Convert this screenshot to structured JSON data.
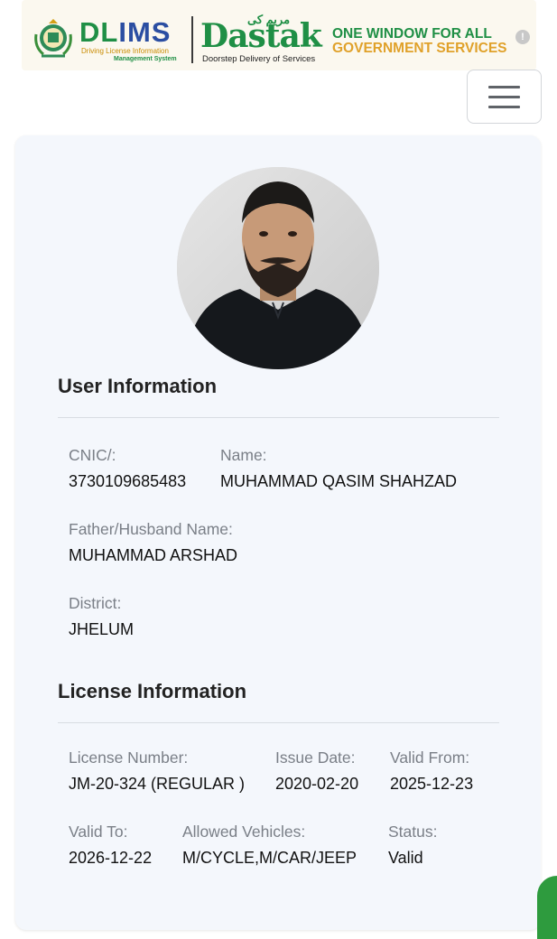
{
  "header": {
    "dlims": {
      "word_dl": "DL",
      "word_ims": "IMS",
      "sub1": "Driving License Information",
      "sub2": "Management System"
    },
    "dastak": {
      "urdu": "مریم کی",
      "word": "Dastak",
      "sub": "Doorstep Delivery of Services"
    },
    "tagline_line1": "ONE WINDOW FOR ALL",
    "tagline_line2": "GOVERNMENT SERVICES",
    "info_icon": "!"
  },
  "menu": {
    "icon": "hamburger-menu-icon"
  },
  "user_information": {
    "title": "User Information",
    "cnic_label": "CNIC/:",
    "cnic_value": "3730109685483",
    "name_label": "Name:",
    "name_value": "MUHAMMAD QASIM SHAHZAD",
    "father_label": "Father/Husband Name:",
    "father_value": "MUHAMMAD ARSHAD",
    "district_label": "District:",
    "district_value": "JHELUM"
  },
  "license_information": {
    "title": "License Information",
    "license_number_label": "License Number:",
    "license_number_value": "JM-20-324 (REGULAR )",
    "issue_date_label": "Issue Date:",
    "issue_date_value": "2020-02-20",
    "valid_from_label": "Valid From:",
    "valid_from_value": "2025-12-23",
    "valid_to_label": "Valid To:",
    "valid_to_value": "2026-12-22",
    "allowed_vehicles_label": "Allowed Vehicles:",
    "allowed_vehicles_value": "M/CYCLE,M/CAR/JEEP",
    "status_label": "Status:",
    "status_value": "Valid"
  },
  "colors": {
    "brand_green": "#1f8f45",
    "brand_orange": "#e0a12a",
    "brand_blue": "#2b4ea2",
    "card_bg": "#f4f7fc"
  }
}
